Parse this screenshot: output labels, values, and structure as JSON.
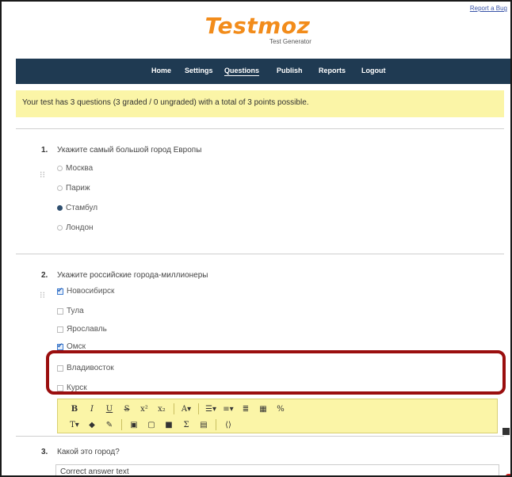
{
  "header": {
    "report_link": "Report a Bug",
    "logo": "Testmoz",
    "logo_subtitle": "Test Generator"
  },
  "nav": {
    "items": [
      "Home",
      "Settings",
      "Questions",
      "Publish",
      "Reports",
      "Logout"
    ],
    "active": "Questions"
  },
  "info_bar": {
    "text": "Your test has 3 questions (3 graded / 0 ungraded) with a total of 3 points possible."
  },
  "questions": [
    {
      "number": "1.",
      "text": "Укажите самый большой город Европы",
      "type": "radio",
      "choices": [
        {
          "label": "Москва",
          "selected": false
        },
        {
          "label": "Париж",
          "selected": false
        },
        {
          "label": "Стамбул",
          "selected": true
        },
        {
          "label": "Лондон",
          "selected": false
        }
      ]
    },
    {
      "number": "2.",
      "text": "Укажите российские города-миллионеры",
      "type": "checkbox",
      "choices": [
        {
          "label": "Новосибирск",
          "selected": true
        },
        {
          "label": "Тула",
          "selected": false
        },
        {
          "label": "Ярославль",
          "selected": false
        },
        {
          "label": "Омск",
          "selected": true
        },
        {
          "label": "Владивосток",
          "selected": false
        },
        {
          "label": "Курск",
          "selected": false
        }
      ]
    },
    {
      "number": "3.",
      "text": "Какой это город?",
      "answer_value": "Correct answer text"
    }
  ],
  "toolbar": {
    "row1": [
      "B",
      "I",
      "U",
      "S",
      "x²",
      "x₂",
      "A▾",
      "☰▾",
      "≡▾",
      "≣",
      "▦",
      "%"
    ],
    "row2": [
      "T▾",
      "◆",
      "✎",
      "▣",
      "▢",
      "■",
      "Σ",
      "▤",
      "⟨⟩"
    ]
  },
  "icons": {
    "drag": "drag-handle-icon",
    "add": "add-square-icon"
  },
  "colors": {
    "nav_bg": "#1f3a52",
    "highlight_bg": "#fbf5a7",
    "logo": "#f28c1b",
    "annotation_box": "#9a0e0e"
  }
}
